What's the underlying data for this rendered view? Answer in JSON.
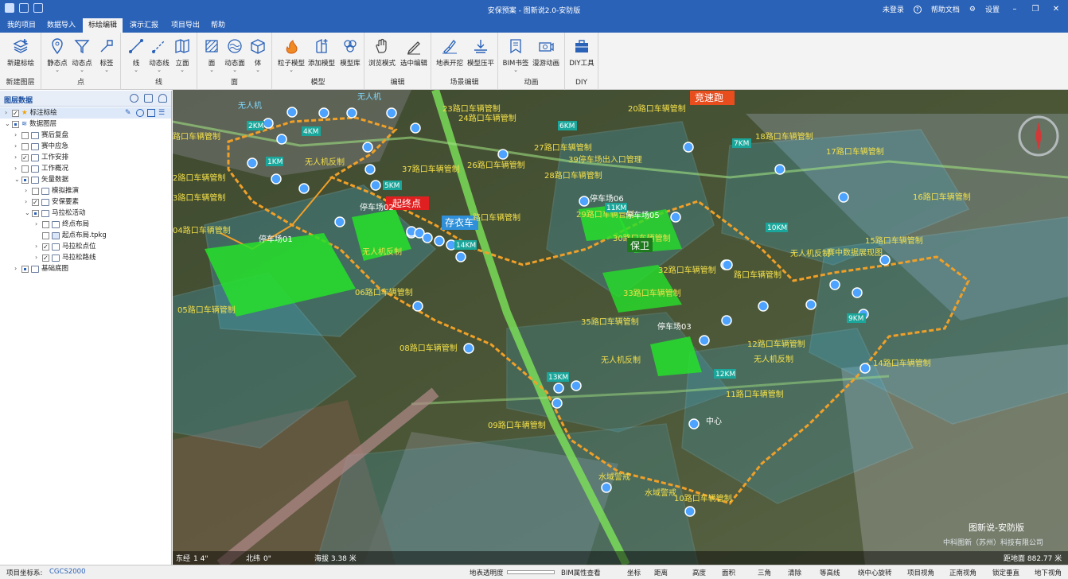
{
  "titlebar": {
    "title": "安保预案 - 图新说2.0-安防版",
    "login": "未登录",
    "help": "帮助文档",
    "settings": "设置"
  },
  "menu": [
    {
      "label": "我的项目"
    },
    {
      "label": "数据导入"
    },
    {
      "label": "标绘编辑",
      "active": true
    },
    {
      "label": "演示汇报"
    },
    {
      "label": "项目导出"
    },
    {
      "label": "帮助"
    }
  ],
  "ribbon": {
    "groups": [
      {
        "label": "新建图层",
        "buttons": [
          {
            "label": "新建标绘",
            "icon": "layers-plus-icon"
          }
        ]
      },
      {
        "label": "点",
        "buttons": [
          {
            "label": "静态点",
            "icon": "pin-icon",
            "dd": "⌄"
          },
          {
            "label": "动态点",
            "icon": "funnel-point-icon",
            "dd": "⌄"
          },
          {
            "label": "标签",
            "icon": "label-icon",
            "dd": "⌄"
          }
        ]
      },
      {
        "label": "线",
        "buttons": [
          {
            "label": "线",
            "icon": "line-icon",
            "dd": "⌄"
          },
          {
            "label": "动态线",
            "icon": "dynamic-line-icon",
            "dd": "⌄"
          },
          {
            "label": "立面",
            "icon": "facade-icon",
            "dd": "⌄"
          }
        ]
      },
      {
        "label": "面",
        "buttons": [
          {
            "label": "面",
            "icon": "polygon-icon",
            "dd": "⌄"
          },
          {
            "label": "动态面",
            "icon": "dynamic-polygon-icon",
            "dd": "⌄"
          },
          {
            "label": "体",
            "icon": "cube-icon",
            "dd": "⌄"
          }
        ]
      },
      {
        "label": "模型",
        "buttons": [
          {
            "label": "粒子模型",
            "icon": "fire-icon",
            "dd": "⌄"
          },
          {
            "label": "添加模型",
            "icon": "building-plus-icon"
          },
          {
            "label": "模型库",
            "icon": "model-library-icon"
          }
        ]
      },
      {
        "label": "编辑",
        "buttons": [
          {
            "label": "浏览模式",
            "icon": "hand-icon"
          },
          {
            "label": "选中编辑",
            "icon": "pen-edit-icon"
          }
        ]
      },
      {
        "label": "场景编辑",
        "buttons": [
          {
            "label": "地表开挖",
            "icon": "excavate-icon"
          },
          {
            "label": "模型压平",
            "icon": "flatten-icon"
          }
        ]
      },
      {
        "label": "动画",
        "buttons": [
          {
            "label": "BIM书签",
            "icon": "bookmark-icon",
            "dd": "⌄"
          },
          {
            "label": "漫游动画",
            "icon": "camera-roam-icon"
          }
        ]
      },
      {
        "label": "DIY",
        "buttons": [
          {
            "label": "DIY工具",
            "icon": "toolbox-icon"
          }
        ]
      }
    ]
  },
  "panel": {
    "title": "图层数据",
    "tree": [
      {
        "label": "标注标绘",
        "level": 0,
        "check": "on",
        "icon": "star-icon",
        "selected": true
      },
      {
        "label": "数据图层",
        "level": 0,
        "check": "part",
        "icon": "database-icon"
      },
      {
        "label": "赛后复盘",
        "level": 1,
        "check": "off"
      },
      {
        "label": "赛中应急",
        "level": 1,
        "check": "off"
      },
      {
        "label": "工作安排",
        "level": 1,
        "check": "on"
      },
      {
        "label": "工作概况",
        "level": 1,
        "check": "off"
      },
      {
        "label": "矢量数据",
        "level": 1,
        "check": "part"
      },
      {
        "label": "模拟推演",
        "level": 2,
        "check": "off"
      },
      {
        "label": "安保要素",
        "level": 2,
        "check": "on"
      },
      {
        "label": "马拉松活动",
        "level": 2,
        "check": "part"
      },
      {
        "label": "终点布局",
        "level": 3,
        "check": "off"
      },
      {
        "label": "起点布局.tpkg",
        "level": 3,
        "check": "off"
      },
      {
        "label": "马拉松点位",
        "level": 3,
        "check": "on"
      },
      {
        "label": "马拉松路线",
        "level": 3,
        "check": "on"
      },
      {
        "label": "基础底图",
        "level": 1,
        "check": "part"
      }
    ]
  },
  "map": {
    "labels": {
      "l1": "无人机",
      "l2": "无人机",
      "l3": "竞速跑",
      "l4": "20路口车辆管制",
      "l5": "23路口车辆管制",
      "l6": "24路口车辆管制",
      "l7": "路口车辆管制",
      "l8": "18路口车辆管制",
      "l9": "17路口车辆管制",
      "l10": "27路口车辆管制",
      "l11": "39停车场出入口管理",
      "l12": "2路口车辆管制",
      "l13": "37路口车辆管制",
      "l14": "26路口车辆管制",
      "l15": "28路口车辆管制",
      "l16": "3路口车辆管制",
      "l17": "停车场06",
      "l18": "16路口车辆管制",
      "l19": "起终点",
      "l20": "停车场02",
      "l21": "存衣车",
      "l22": "29路口车辆管制",
      "l23": "停车场05",
      "l24": "路口车辆管制",
      "l25": "04路口车辆管制",
      "l26": "停车场01",
      "l27": "30路口车辆管制",
      "l28": "15路口车辆管制",
      "l29": "无人机反制",
      "l30": "保卫",
      "l31": "无人机反制",
      "l32": "无人机反制",
      "l33": "32路口车辆管制",
      "l34": "路口车辆管制",
      "l35": "06路口车辆管制",
      "l36": "33路口车辆管制",
      "l37": "05路口车辆管制",
      "l38": "35路口车辆管制",
      "l39": "停车场03",
      "l40": "08路口车辆管制",
      "l41": "12路口车辆管制",
      "l42": "无人机反制",
      "l43": "14路口车辆管制",
      "l44": "无人机反制",
      "l45": "11路口车辆管制",
      "l46": "09路口车辆管制",
      "l47": "水域警戒",
      "l48": "10路口车辆管制",
      "l49": "中心",
      "l50": "水域警戒",
      "l51": "赛中数据展现图"
    },
    "km": [
      "2KM",
      "4KM",
      "1KM",
      "5KM",
      "6KM",
      "7KM",
      "10KM",
      "11KM",
      "14KM",
      "9KM",
      "12KM",
      "13KM"
    ],
    "brand": {
      "name": "图新说-安防版",
      "company": "中科图新（苏州）科技有限公司"
    },
    "coords": {
      "lon_label": "东经",
      "lon": "1      4\"",
      "lat_label": "北纬",
      "lat": "     0\"",
      "alt": "海拔 3.38 米",
      "dist": "距地面 882.77 米"
    }
  },
  "status": {
    "crs_label": "项目坐标系:",
    "crs": "CGCS2000",
    "transp": "地表透明度",
    "tools": [
      "BIM属性查看",
      "坐标",
      "距离",
      "高度",
      "面积",
      "三角",
      "清除",
      "等高线",
      "绕中心旋转",
      "项目视角",
      "正南视角",
      "锁定垂直",
      "地下视角"
    ]
  },
  "colors": {
    "accent": "#2a62b8",
    "route": "#e89a2a",
    "green": "#26e02a",
    "label": "#c9a227"
  }
}
